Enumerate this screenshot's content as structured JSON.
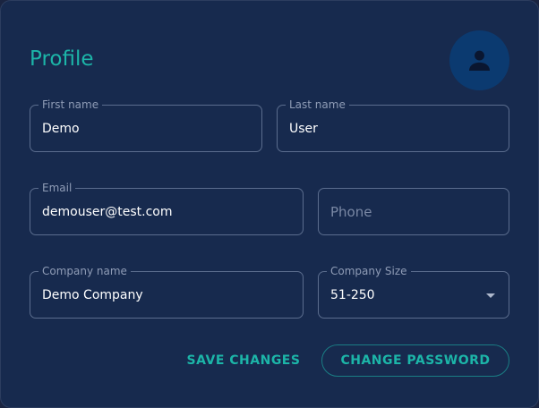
{
  "profile": {
    "title": "Profile",
    "avatar_icon": "user-icon",
    "fields": {
      "first_name": {
        "label": "First name",
        "value": "Demo"
      },
      "last_name": {
        "label": "Last name",
        "value": "User"
      },
      "email": {
        "label": "Email",
        "value": "demouser@test.com"
      },
      "phone": {
        "placeholder": "Phone",
        "value": ""
      },
      "company_name": {
        "label": "Company name",
        "value": "Demo Company"
      },
      "company_size": {
        "label": "Company Size",
        "value": "51-250",
        "icon": "caret-down-icon"
      }
    },
    "actions": {
      "save_label": "SAVE CHANGES",
      "change_password_label": "CHANGE PASSWORD"
    },
    "colors": {
      "accent": "#1cb5a8",
      "card_background": "#172a4e",
      "avatar_background": "#0b3a70"
    }
  }
}
